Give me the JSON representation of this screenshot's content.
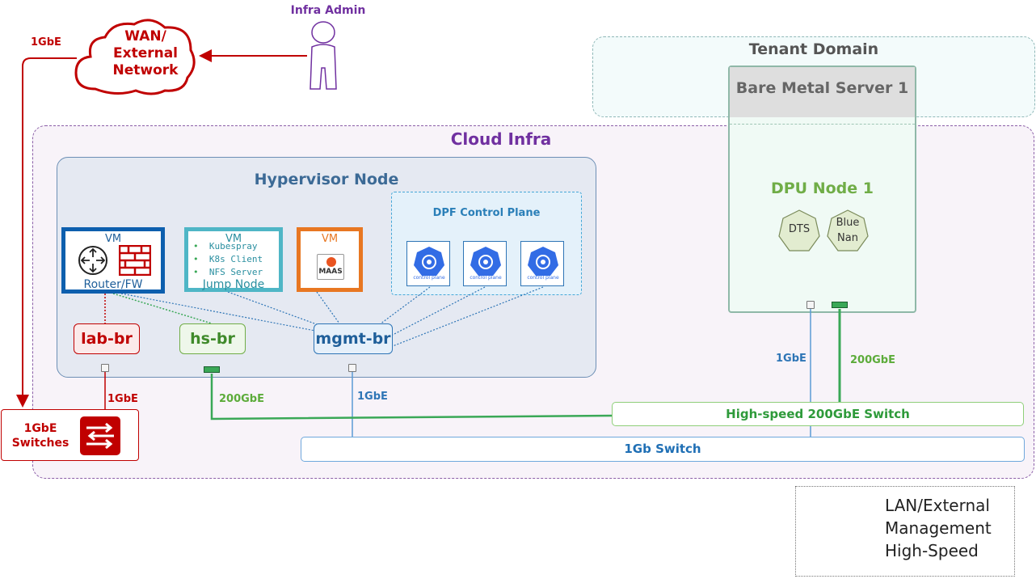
{
  "admin": {
    "label": "Infra Admin"
  },
  "wan": {
    "line1": "WAN/",
    "line2": "External",
    "line3": "Network"
  },
  "tenant": {
    "title": "Tenant Domain"
  },
  "cloud": {
    "title": "Cloud Infra"
  },
  "hypervisor": {
    "title": "Hypervisor Node"
  },
  "dpf": {
    "title": "DPF Control Plane",
    "icon_caption": "control plane"
  },
  "vms": {
    "router": {
      "tag": "VM",
      "label": "Router/FW"
    },
    "jump": {
      "tag": "VM",
      "items": [
        "Kubespray",
        "K8s Client",
        "NFS Server"
      ],
      "label": "Jump Node"
    },
    "maas": {
      "tag": "VM",
      "label": "MAAS"
    }
  },
  "bridges": {
    "lab": "lab-br",
    "hs": "hs-br",
    "mgmt": "mgmt-br"
  },
  "server": {
    "title": "Bare Metal  Server 1",
    "dpu_title": "DPU Node 1",
    "dts": "DTS",
    "bluenan_1": "Blue",
    "bluenan_2": "Nan"
  },
  "switches": {
    "highspeed": "High-speed 200GbE Switch",
    "onegb": "1Gb Switch",
    "red_line1": "1GbE",
    "red_line2": "Switches"
  },
  "links": {
    "wan_1gbe": "1GbE",
    "lab_1gbe": "1GbE",
    "hs_200": "200GbE",
    "mgmt_1gbe": "1GbE",
    "dpu_1gbe": "1GbE",
    "dpu_200": "200GbE"
  },
  "legend": {
    "lan": "LAN/External",
    "mgmt": "Management",
    "hs": "High-Speed"
  },
  "colors": {
    "lan": "#c00000",
    "mgmt": "#5b9bd5",
    "hs": "#5cb85c",
    "purple": "#7030a0",
    "dpu_green": "#70ad47"
  }
}
